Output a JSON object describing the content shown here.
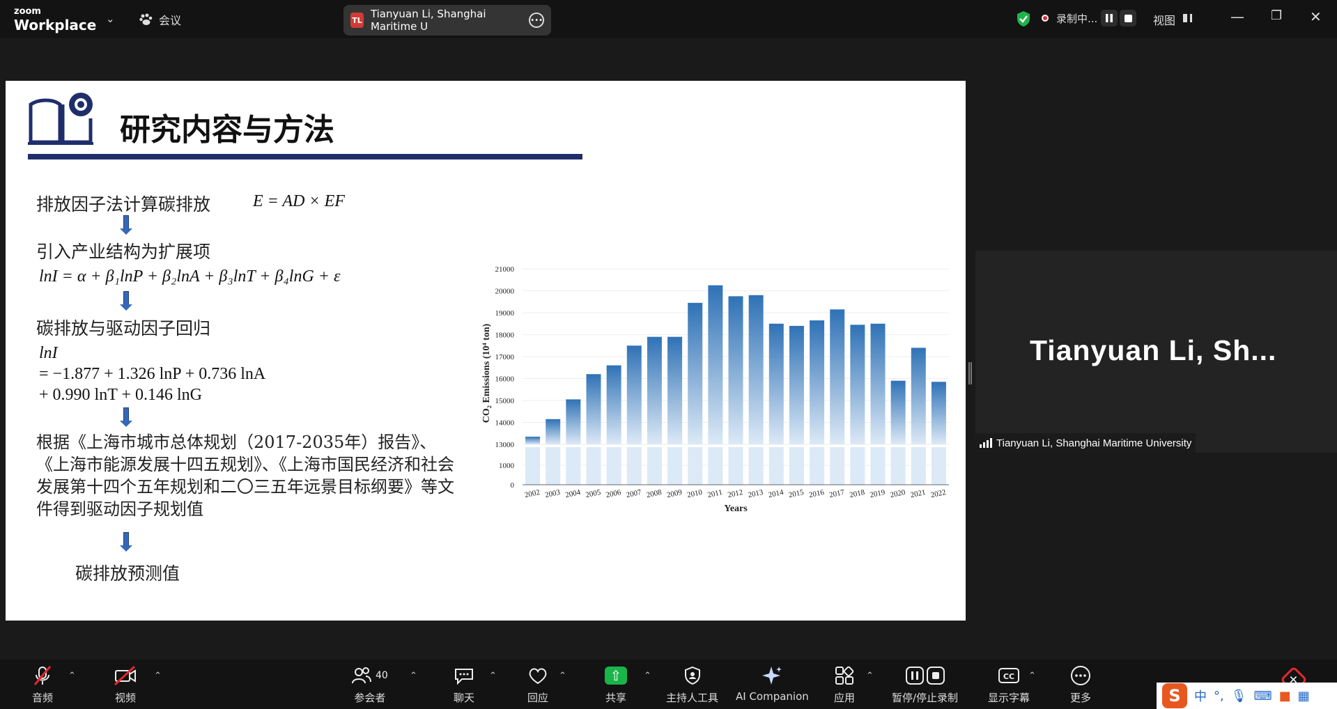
{
  "app": {
    "brand_small": "zoom",
    "brand_main": "Workplace",
    "meeting_label": "会议"
  },
  "tab": {
    "badge": "TL",
    "title": "Tianyuan Li, Shanghai Maritime U"
  },
  "recording": {
    "label": "录制中..."
  },
  "view_label": "视图",
  "slide": {
    "title": "研究内容与方法",
    "step1": "排放因子法计算碳排放",
    "eq1": "E = AD × EF",
    "step2": "引入产业结构为扩展项",
    "eq2": "lnI = α + β₁lnP + β₂lnA + β₃lnT + β₄lnG + ε",
    "step3": "碳排放与驱动因子回归",
    "eq3a": "lnI",
    "eq3b": "= −1.877 + 1.326 lnP + 0.736 lnA",
    "eq3c": "+ 0.990 lnT + 0.146 lnG",
    "para": "根据《上海市城市总体规划（2017-2035年）报告》、《上海市能源发展十四五规划》、《上海市国民经济和社会发展第十四个五年规划和二〇三五年远景目标纲要》等文件得到驱动因子规划值",
    "step4": "碳排放预测值"
  },
  "chart_data": {
    "type": "bar",
    "categories": [
      "2002",
      "2003",
      "2004",
      "2005",
      "2006",
      "2007",
      "2008",
      "2009",
      "2010",
      "2011",
      "2012",
      "2013",
      "2014",
      "2015",
      "2016",
      "2017",
      "2018",
      "2019",
      "2020",
      "2021",
      "2022"
    ],
    "values": [
      13350,
      14150,
      15050,
      16200,
      16600,
      17500,
      17900,
      17900,
      19450,
      20250,
      19750,
      19800,
      18500,
      18400,
      18650,
      19150,
      18450,
      18500,
      15900,
      17400,
      15850
    ],
    "xlabel": "Years",
    "ylabel": "CO₂ Emissions (10⁴ ton)",
    "yticks": [
      "0",
      "1000",
      "13000",
      "14000",
      "15000",
      "16000",
      "17000",
      "18000",
      "19000",
      "20000",
      "21000"
    ],
    "axis_break": true,
    "bar_color_top": "#2f72b6",
    "bar_color_bottom": "#dce9f6"
  },
  "participant": {
    "display_name": "Tianyuan Li, Sh...",
    "label": "Tianyuan Li, Shanghai Maritime University"
  },
  "toolbar": {
    "audio": "音频",
    "video": "视频",
    "participants": "参会者",
    "participants_count": "40",
    "chat": "聊天",
    "react": "回应",
    "share": "共享",
    "host_tools": "主持人工具",
    "ai": "AI Companion",
    "apps": "应用",
    "record": "暂停/停止录制",
    "captions": "显示字幕",
    "more": "更多"
  },
  "ime": {
    "lang": "中"
  }
}
